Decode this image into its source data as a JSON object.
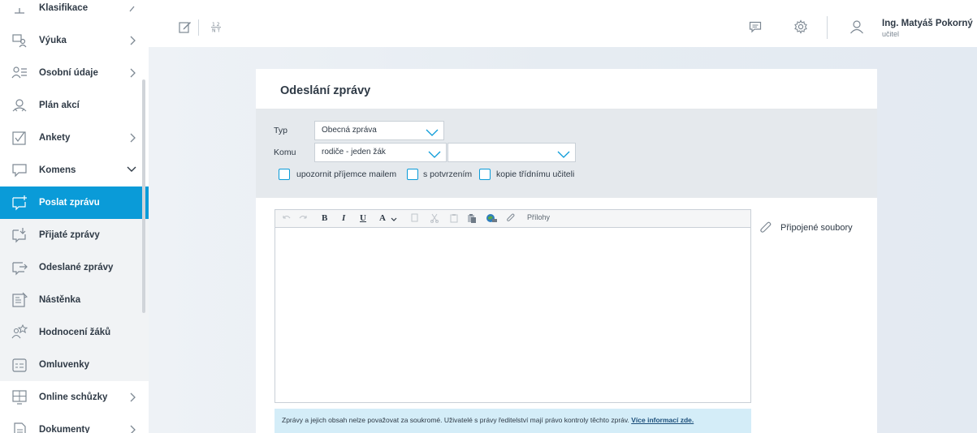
{
  "sidebar": {
    "items": [
      {
        "label": "Klasifikace",
        "icon": "grade-icon",
        "chevron": "right"
      },
      {
        "label": "Výuka",
        "icon": "teaching-icon",
        "chevron": "right"
      },
      {
        "label": "Osobní údaje",
        "icon": "personal-data-icon",
        "chevron": "right"
      },
      {
        "label": "Plán akcí",
        "icon": "events-icon",
        "chevron": ""
      },
      {
        "label": "Ankety",
        "icon": "poll-icon",
        "chevron": "right"
      },
      {
        "label": "Komens",
        "icon": "komens-icon",
        "chevron": "down"
      },
      {
        "label": "Poslat zprávu",
        "icon": "send-message-icon",
        "chevron": ""
      },
      {
        "label": "Přijaté zprávy",
        "icon": "inbox-icon",
        "chevron": ""
      },
      {
        "label": "Odeslané zprávy",
        "icon": "sent-icon",
        "chevron": ""
      },
      {
        "label": "Nástěnka",
        "icon": "noticeboard-icon",
        "chevron": ""
      },
      {
        "label": "Hodnocení žáků",
        "icon": "student-rating-icon",
        "chevron": ""
      },
      {
        "label": "Omluvenky",
        "icon": "excuse-icon",
        "chevron": ""
      },
      {
        "label": "Online schůzky",
        "icon": "online-meeting-icon",
        "chevron": "right"
      },
      {
        "label": "Dokumenty",
        "icon": "documents-icon",
        "chevron": "right"
      }
    ]
  },
  "topbar": {
    "user_name": "Ing. Matyáš Pokorný",
    "user_role": "učitel"
  },
  "form": {
    "title": "Odeslání zprávy",
    "type_label": "Typ",
    "type_value": "Obecná zpráva",
    "to_label": "Komu",
    "to_value": "rodiče - jeden žák",
    "to_value2": "",
    "cb_email": "upozornit příjemce mailem",
    "cb_confirm": "s potvrzením",
    "cb_copy": "kopie třídnímu učiteli",
    "toolbar_attachments": "Přílohy",
    "attached_files": "Připojené soubory",
    "notice_text": "Zprávy a jejich obsah nelze považovat za soukromé. Uživatelé s právy ředitelství mají právo kontroly těchto zpráv. ",
    "notice_link": "Více informací zde."
  },
  "colors": {
    "accent": "#0a9bd8",
    "sidebar_sub_bg": "#f1f3f5",
    "form_bg": "#e5e9ed",
    "notice_bg": "#d4edf8"
  }
}
